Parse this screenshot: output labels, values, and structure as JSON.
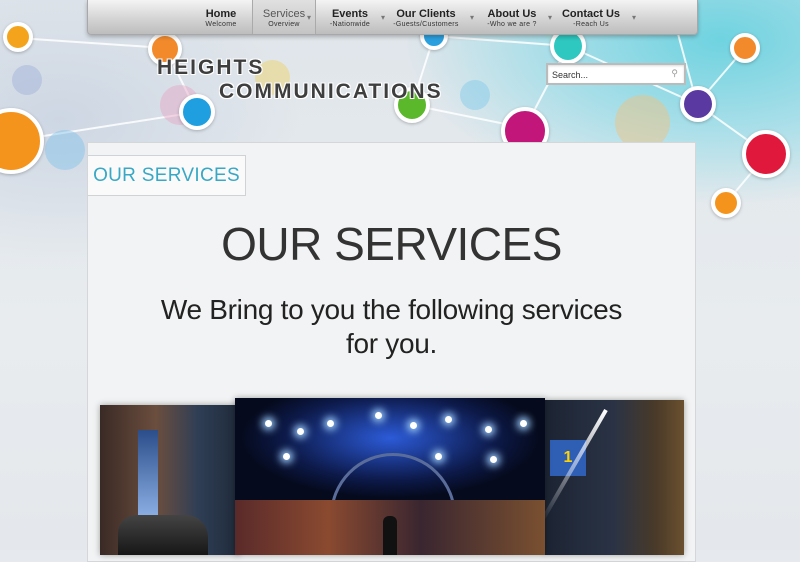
{
  "nav": {
    "items": [
      {
        "label": "Home",
        "sub": "Welcome"
      },
      {
        "label": "Services",
        "sub": "Overview"
      },
      {
        "label": "Events",
        "sub": "-Nationwide"
      },
      {
        "label": "Our Clients",
        "sub": "-Guests/Customers"
      },
      {
        "label": "About Us",
        "sub": "-Who we are ?"
      },
      {
        "label": "Contact Us",
        "sub": "-Reach Us"
      }
    ],
    "active": "Services"
  },
  "logo": {
    "line1": "HEIGHTS",
    "line2": "COMMUNICATIONS"
  },
  "search": {
    "placeholder": "Search..."
  },
  "main": {
    "section_tab": "OUR SERVICES",
    "title": "OUR SERVICES",
    "lead": "We Bring to you the following services for you."
  },
  "photos": {
    "right_sign_text": "1"
  },
  "colors": {
    "accent_teal": "#39a8c5",
    "title_text": "#333333"
  }
}
